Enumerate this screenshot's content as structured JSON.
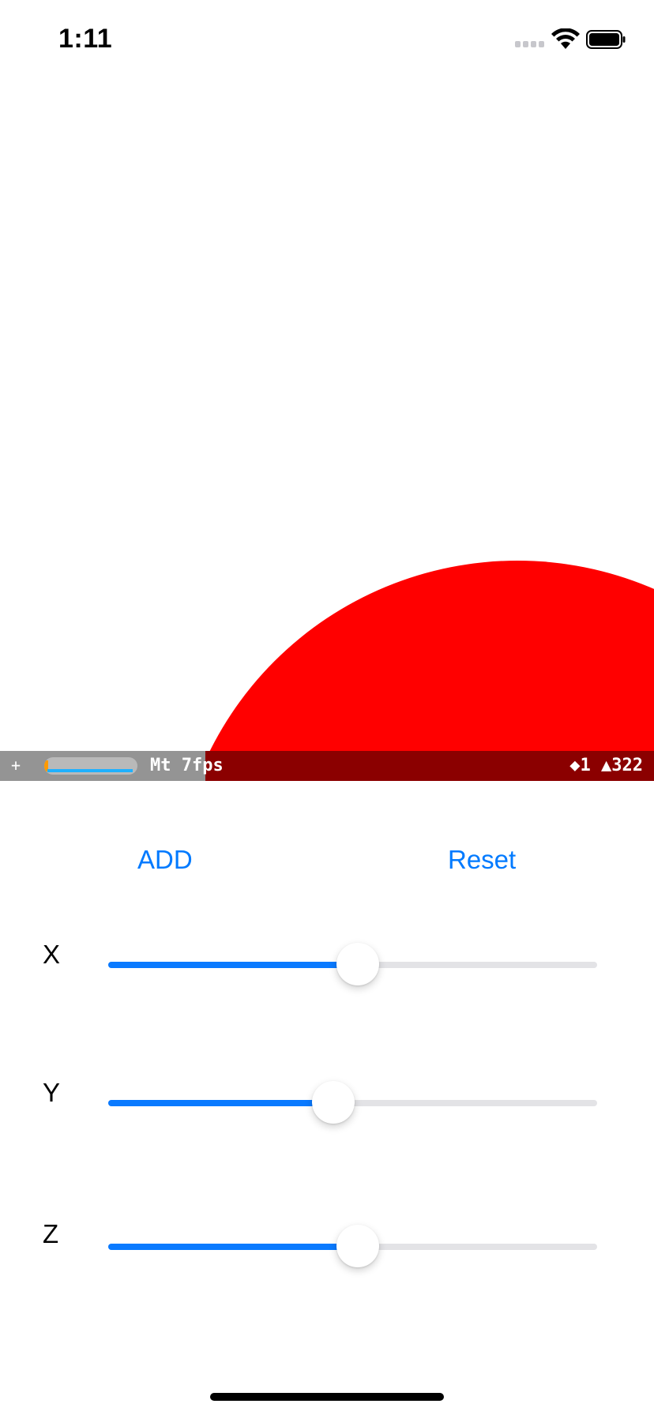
{
  "status_bar": {
    "time": "1:11",
    "icons": [
      "cellular-signal-icon",
      "wifi-icon",
      "battery-icon"
    ]
  },
  "scene": {
    "object_color": "#ff0000",
    "object_shape": "sphere"
  },
  "stats": {
    "toggle_label": "+",
    "renderer_label": "Mt 7fps",
    "counts_label": "◆1 ▲322",
    "overlay_tint": "#8b0000"
  },
  "buttons": {
    "add_label": "ADD",
    "reset_label": "Reset"
  },
  "sliders": [
    {
      "label": "X",
      "value": 0.51
    },
    {
      "label": "Y",
      "value": 0.46
    },
    {
      "label": "Z",
      "value": 0.51
    }
  ],
  "colors": {
    "accent": "#007aff",
    "track": "#e3e3e6"
  }
}
